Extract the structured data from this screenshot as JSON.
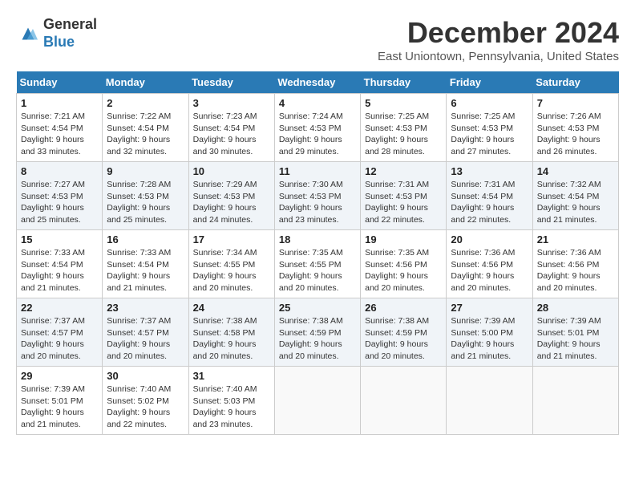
{
  "logo": {
    "line1": "General",
    "line2": "Blue"
  },
  "title": "December 2024",
  "location": "East Uniontown, Pennsylvania, United States",
  "days_of_week": [
    "Sunday",
    "Monday",
    "Tuesday",
    "Wednesday",
    "Thursday",
    "Friday",
    "Saturday"
  ],
  "weeks": [
    [
      {
        "day": "1",
        "info": "Sunrise: 7:21 AM\nSunset: 4:54 PM\nDaylight: 9 hours and 33 minutes."
      },
      {
        "day": "2",
        "info": "Sunrise: 7:22 AM\nSunset: 4:54 PM\nDaylight: 9 hours and 32 minutes."
      },
      {
        "day": "3",
        "info": "Sunrise: 7:23 AM\nSunset: 4:54 PM\nDaylight: 9 hours and 30 minutes."
      },
      {
        "day": "4",
        "info": "Sunrise: 7:24 AM\nSunset: 4:53 PM\nDaylight: 9 hours and 29 minutes."
      },
      {
        "day": "5",
        "info": "Sunrise: 7:25 AM\nSunset: 4:53 PM\nDaylight: 9 hours and 28 minutes."
      },
      {
        "day": "6",
        "info": "Sunrise: 7:25 AM\nSunset: 4:53 PM\nDaylight: 9 hours and 27 minutes."
      },
      {
        "day": "7",
        "info": "Sunrise: 7:26 AM\nSunset: 4:53 PM\nDaylight: 9 hours and 26 minutes."
      }
    ],
    [
      {
        "day": "8",
        "info": "Sunrise: 7:27 AM\nSunset: 4:53 PM\nDaylight: 9 hours and 25 minutes."
      },
      {
        "day": "9",
        "info": "Sunrise: 7:28 AM\nSunset: 4:53 PM\nDaylight: 9 hours and 25 minutes."
      },
      {
        "day": "10",
        "info": "Sunrise: 7:29 AM\nSunset: 4:53 PM\nDaylight: 9 hours and 24 minutes."
      },
      {
        "day": "11",
        "info": "Sunrise: 7:30 AM\nSunset: 4:53 PM\nDaylight: 9 hours and 23 minutes."
      },
      {
        "day": "12",
        "info": "Sunrise: 7:31 AM\nSunset: 4:53 PM\nDaylight: 9 hours and 22 minutes."
      },
      {
        "day": "13",
        "info": "Sunrise: 7:31 AM\nSunset: 4:54 PM\nDaylight: 9 hours and 22 minutes."
      },
      {
        "day": "14",
        "info": "Sunrise: 7:32 AM\nSunset: 4:54 PM\nDaylight: 9 hours and 21 minutes."
      }
    ],
    [
      {
        "day": "15",
        "info": "Sunrise: 7:33 AM\nSunset: 4:54 PM\nDaylight: 9 hours and 21 minutes."
      },
      {
        "day": "16",
        "info": "Sunrise: 7:33 AM\nSunset: 4:54 PM\nDaylight: 9 hours and 21 minutes."
      },
      {
        "day": "17",
        "info": "Sunrise: 7:34 AM\nSunset: 4:55 PM\nDaylight: 9 hours and 20 minutes."
      },
      {
        "day": "18",
        "info": "Sunrise: 7:35 AM\nSunset: 4:55 PM\nDaylight: 9 hours and 20 minutes."
      },
      {
        "day": "19",
        "info": "Sunrise: 7:35 AM\nSunset: 4:56 PM\nDaylight: 9 hours and 20 minutes."
      },
      {
        "day": "20",
        "info": "Sunrise: 7:36 AM\nSunset: 4:56 PM\nDaylight: 9 hours and 20 minutes."
      },
      {
        "day": "21",
        "info": "Sunrise: 7:36 AM\nSunset: 4:56 PM\nDaylight: 9 hours and 20 minutes."
      }
    ],
    [
      {
        "day": "22",
        "info": "Sunrise: 7:37 AM\nSunset: 4:57 PM\nDaylight: 9 hours and 20 minutes."
      },
      {
        "day": "23",
        "info": "Sunrise: 7:37 AM\nSunset: 4:57 PM\nDaylight: 9 hours and 20 minutes."
      },
      {
        "day": "24",
        "info": "Sunrise: 7:38 AM\nSunset: 4:58 PM\nDaylight: 9 hours and 20 minutes."
      },
      {
        "day": "25",
        "info": "Sunrise: 7:38 AM\nSunset: 4:59 PM\nDaylight: 9 hours and 20 minutes."
      },
      {
        "day": "26",
        "info": "Sunrise: 7:38 AM\nSunset: 4:59 PM\nDaylight: 9 hours and 20 minutes."
      },
      {
        "day": "27",
        "info": "Sunrise: 7:39 AM\nSunset: 5:00 PM\nDaylight: 9 hours and 21 minutes."
      },
      {
        "day": "28",
        "info": "Sunrise: 7:39 AM\nSunset: 5:01 PM\nDaylight: 9 hours and 21 minutes."
      }
    ],
    [
      {
        "day": "29",
        "info": "Sunrise: 7:39 AM\nSunset: 5:01 PM\nDaylight: 9 hours and 21 minutes."
      },
      {
        "day": "30",
        "info": "Sunrise: 7:40 AM\nSunset: 5:02 PM\nDaylight: 9 hours and 22 minutes."
      },
      {
        "day": "31",
        "info": "Sunrise: 7:40 AM\nSunset: 5:03 PM\nDaylight: 9 hours and 23 minutes."
      },
      null,
      null,
      null,
      null
    ]
  ]
}
